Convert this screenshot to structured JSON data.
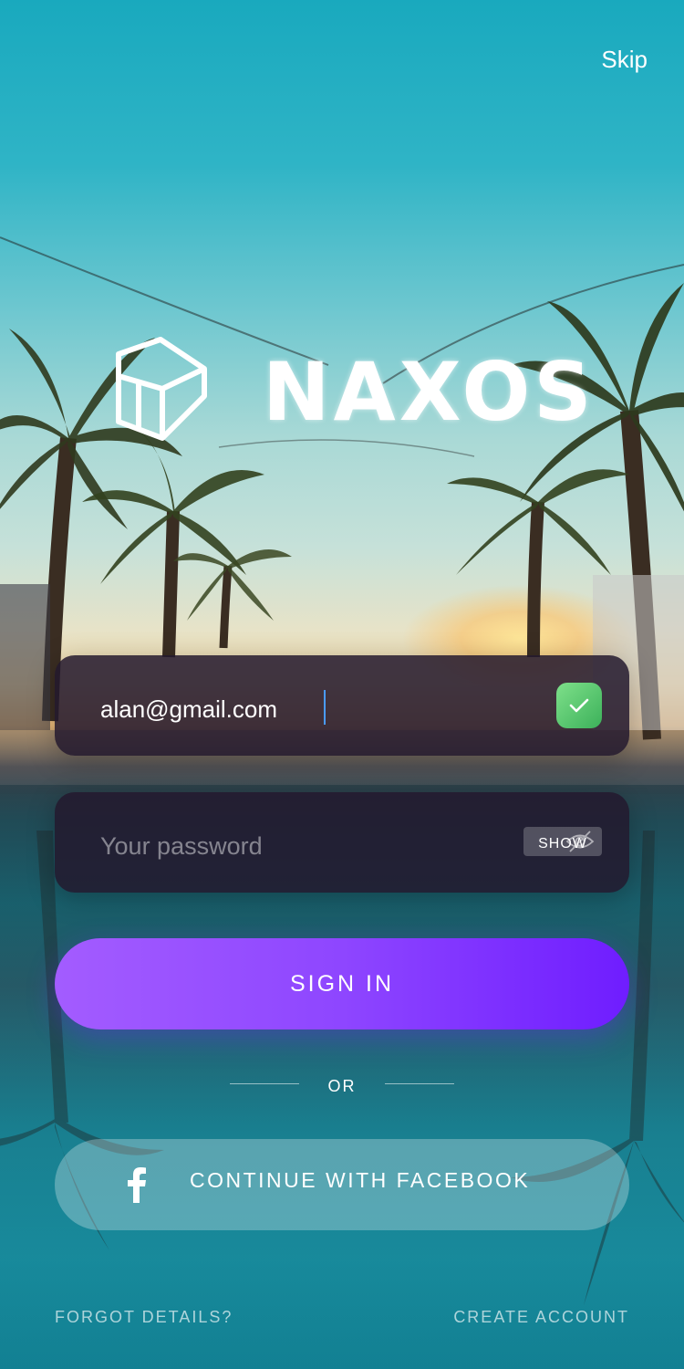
{
  "header": {
    "skip_label": "Skip"
  },
  "brand": {
    "name": "NAXOS",
    "logo_icon": "play-cube-icon"
  },
  "form": {
    "email": {
      "value": "alan@gmail.com",
      "valid_icon": "check-icon"
    },
    "password": {
      "placeholder": "Your password",
      "show_label": "SHOW",
      "visibility_icon": "eye-off-icon"
    },
    "sign_in_label": "SIGN IN",
    "divider_label": "OR",
    "facebook_label": "CONTINUE WITH FACEBOOK",
    "facebook_icon": "facebook-icon"
  },
  "footer": {
    "forgot_label": "FORGOT DETAILS?",
    "create_label": "CREATE ACCOUNT"
  },
  "colors": {
    "primary_gradient_start": "#a35cff",
    "primary_gradient_end": "#6f1dff",
    "valid_green": "#3cb15a",
    "field_background": "#23192d"
  }
}
